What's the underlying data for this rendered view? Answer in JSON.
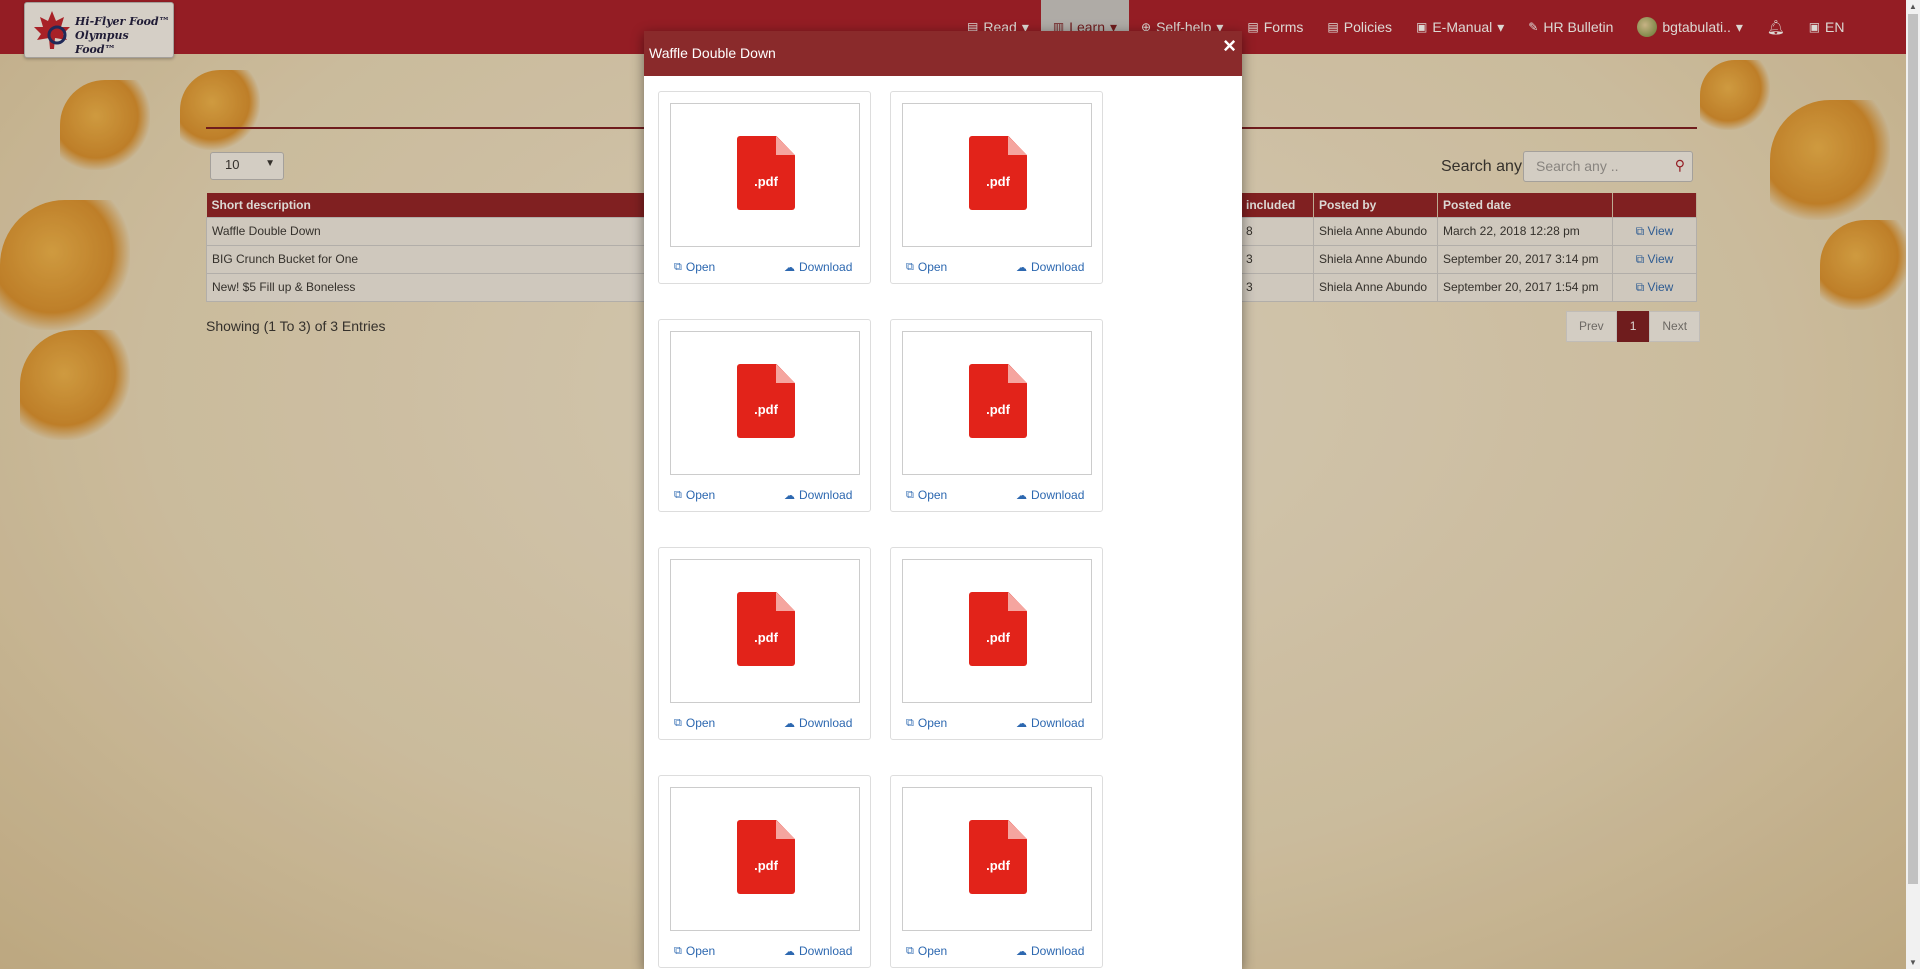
{
  "brand": {
    "line1": "Hi-Flyer Food™",
    "line2": "Olympus Food™"
  },
  "nav": {
    "read": "Read",
    "learn": "Learn",
    "selfhelp": "Self-help",
    "forms": "Forms",
    "policies": "Policies",
    "emanual": "E-Manual",
    "hrbulletin": "HR Bulletin",
    "user": "bgtabulati..",
    "lang": "EN"
  },
  "list": {
    "page_length": "10",
    "search_label": "Search any",
    "search_placeholder": "Search any ..",
    "columns": [
      "Short description",
      "included",
      "Posted by",
      "Posted date",
      ""
    ],
    "rows": [
      {
        "desc": "Waffle Double Down",
        "included": "8",
        "posted_by": "Shiela Anne Abundo",
        "date": "March 22, 2018 12:28 pm",
        "action": "View"
      },
      {
        "desc": "BIG Crunch Bucket for One",
        "included": "3",
        "posted_by": "Shiela Anne Abundo",
        "date": "September 20, 2017 3:14 pm",
        "action": "View"
      },
      {
        "desc": "New! $5 Fill up & Boneless",
        "included": "3",
        "posted_by": "Shiela Anne Abundo",
        "date": "September 20, 2017 1:54 pm",
        "action": "View"
      }
    ],
    "showing": "Showing (1 To 3) of 3 Entries",
    "pager": {
      "prev": "Prev",
      "current": "1",
      "next": "Next"
    }
  },
  "modal": {
    "title": "Waffle Double Down",
    "close": "×",
    "file_label": ".pdf",
    "open_label": "Open",
    "download_label": "Download"
  },
  "colors": {
    "brand_red": "#a81b2a",
    "header_maroon": "#8f1f27",
    "link_blue": "#2d68b0",
    "pdf_red": "#e2231a"
  }
}
